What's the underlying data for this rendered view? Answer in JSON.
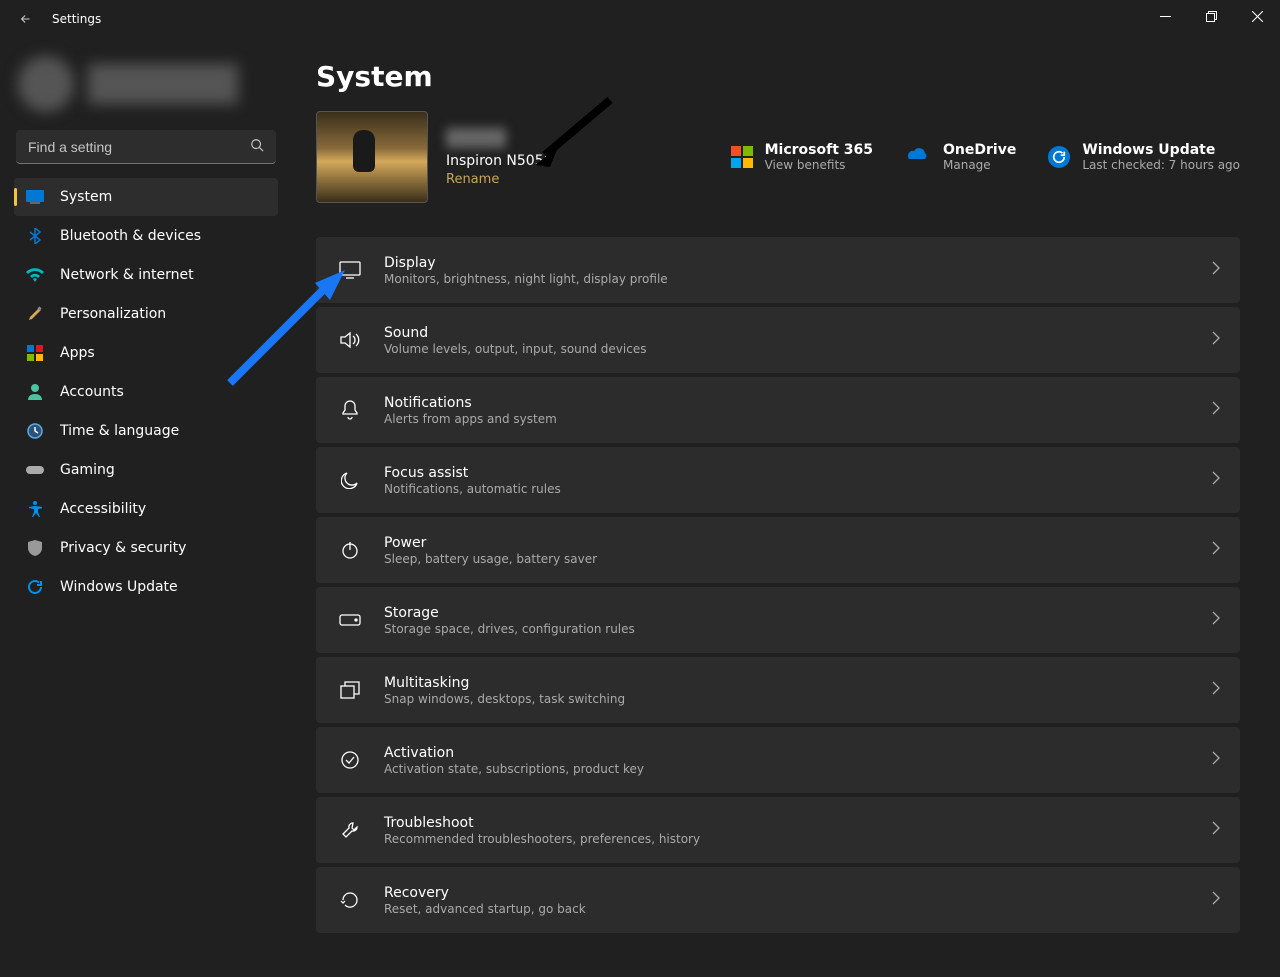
{
  "window": {
    "title": "Settings"
  },
  "search": {
    "placeholder": "Find a setting"
  },
  "sidebar": {
    "items": [
      {
        "label": "System"
      },
      {
        "label": "Bluetooth & devices"
      },
      {
        "label": "Network & internet"
      },
      {
        "label": "Personalization"
      },
      {
        "label": "Apps"
      },
      {
        "label": "Accounts"
      },
      {
        "label": "Time & language"
      },
      {
        "label": "Gaming"
      },
      {
        "label": "Accessibility"
      },
      {
        "label": "Privacy & security"
      },
      {
        "label": "Windows Update"
      }
    ]
  },
  "main": {
    "title": "System",
    "device": {
      "model": "Inspiron N5050",
      "rename": "Rename"
    },
    "cards": {
      "ms365": {
        "title": "Microsoft 365",
        "sub": "View benefits"
      },
      "onedrive": {
        "title": "OneDrive",
        "sub": "Manage"
      },
      "winupdate": {
        "title": "Windows Update",
        "sub": "Last checked: 7 hours ago"
      }
    },
    "items": [
      {
        "title": "Display",
        "sub": "Monitors, brightness, night light, display profile"
      },
      {
        "title": "Sound",
        "sub": "Volume levels, output, input, sound devices"
      },
      {
        "title": "Notifications",
        "sub": "Alerts from apps and system"
      },
      {
        "title": "Focus assist",
        "sub": "Notifications, automatic rules"
      },
      {
        "title": "Power",
        "sub": "Sleep, battery usage, battery saver"
      },
      {
        "title": "Storage",
        "sub": "Storage space, drives, configuration rules"
      },
      {
        "title": "Multitasking",
        "sub": "Snap windows, desktops, task switching"
      },
      {
        "title": "Activation",
        "sub": "Activation state, subscriptions, product key"
      },
      {
        "title": "Troubleshoot",
        "sub": "Recommended troubleshooters, preferences, history"
      },
      {
        "title": "Recovery",
        "sub": "Reset, advanced startup, go back"
      }
    ]
  }
}
